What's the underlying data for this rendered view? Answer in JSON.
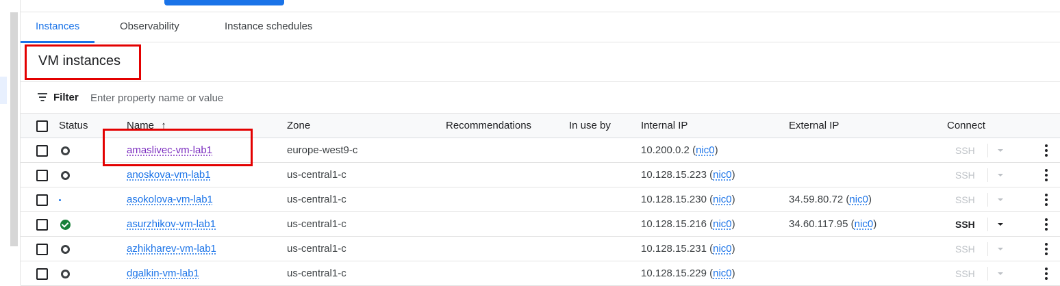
{
  "tabs": [
    {
      "label": "Instances",
      "active": true
    },
    {
      "label": "Observability",
      "active": false
    },
    {
      "label": "Instance schedules",
      "active": false
    }
  ],
  "header": {
    "title": "VM instances"
  },
  "filter": {
    "label": "Filter",
    "placeholder": "Enter property name or value",
    "icon": "filter-icon"
  },
  "table": {
    "columns": {
      "status": "Status",
      "name": "Name",
      "name_sort": "↑",
      "zone": "Zone",
      "recommendations": "Recommendations",
      "in_use_by": "In use by",
      "internal_ip": "Internal IP",
      "external_ip": "External IP",
      "connect": "Connect"
    },
    "rows": [
      {
        "status": "stopped",
        "name": "amaslivec-vm-lab1",
        "zone": "europe-west9-c",
        "internal_ip": "10.200.0.2",
        "internal_nic": "nic0",
        "external_ip": "",
        "external_nic": "",
        "ssh": "SSH",
        "ssh_enabled": false,
        "visited": true
      },
      {
        "status": "stopped",
        "name": "anoskova-vm-lab1",
        "zone": "us-central1-c",
        "internal_ip": "10.128.15.223",
        "internal_nic": "nic0",
        "external_ip": "",
        "external_nic": "",
        "ssh": "SSH",
        "ssh_enabled": false,
        "visited": false
      },
      {
        "status": "starting",
        "name": "asokolova-vm-lab1",
        "zone": "us-central1-c",
        "internal_ip": "10.128.15.230",
        "internal_nic": "nic0",
        "external_ip": "34.59.80.72",
        "external_nic": "nic0",
        "ssh": "SSH",
        "ssh_enabled": false,
        "visited": false
      },
      {
        "status": "running",
        "name": "asurzhikov-vm-lab1",
        "zone": "us-central1-c",
        "internal_ip": "10.128.15.216",
        "internal_nic": "nic0",
        "external_ip": "34.60.117.95",
        "external_nic": "nic0",
        "ssh": "SSH",
        "ssh_enabled": true,
        "visited": false
      },
      {
        "status": "stopped",
        "name": "azhikharev-vm-lab1",
        "zone": "us-central1-c",
        "internal_ip": "10.128.15.231",
        "internal_nic": "nic0",
        "external_ip": "",
        "external_nic": "",
        "ssh": "SSH",
        "ssh_enabled": false,
        "visited": false
      },
      {
        "status": "stopped",
        "name": "dgalkin-vm-lab1",
        "zone": "us-central1-c",
        "internal_ip": "10.128.15.229",
        "internal_nic": "nic0",
        "external_ip": "",
        "external_nic": "",
        "ssh": "SSH",
        "ssh_enabled": false,
        "visited": false
      }
    ]
  },
  "colors": {
    "accent": "#1a73e8",
    "highlight_box": "#e30000",
    "running": "#188038",
    "visited_link": "#7b2cbf"
  }
}
